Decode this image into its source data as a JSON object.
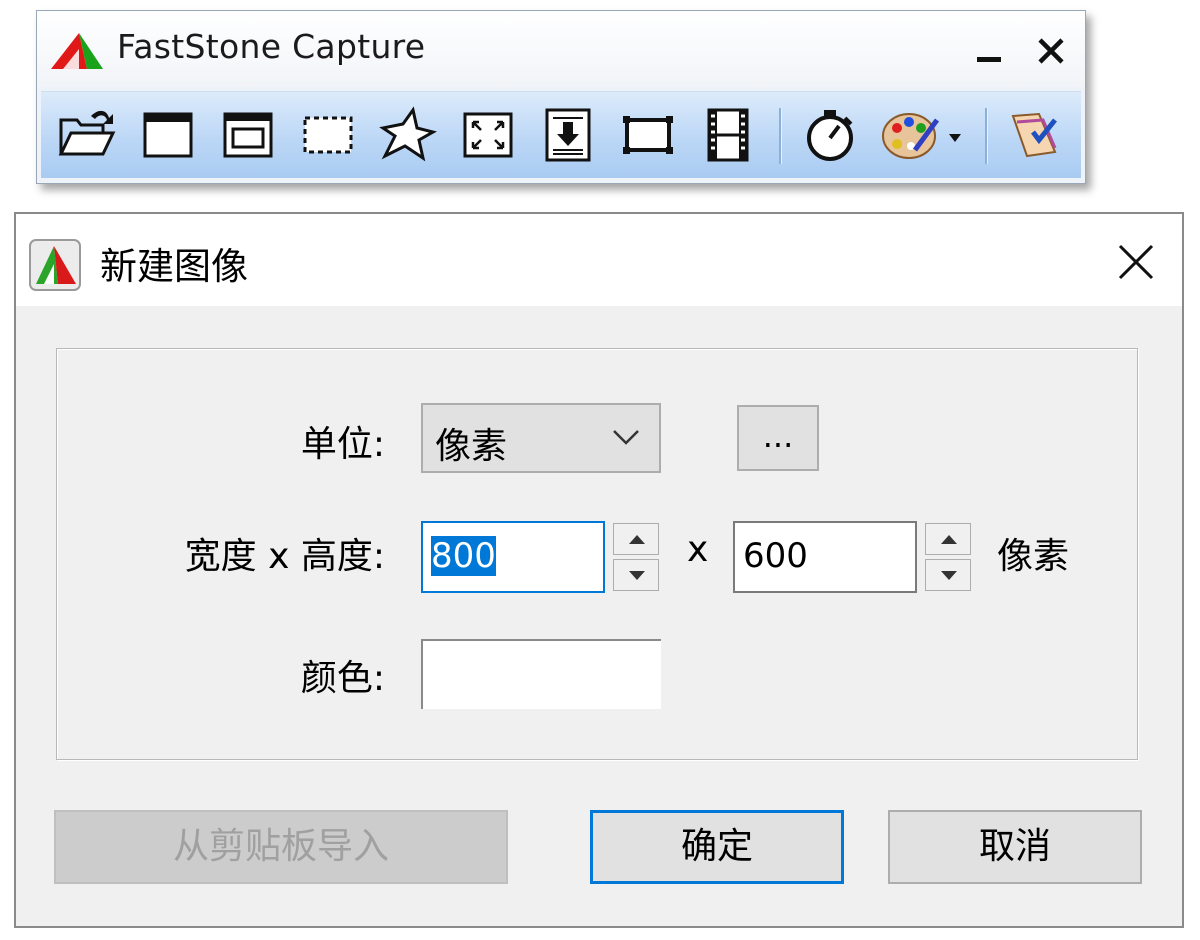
{
  "toolbar_window": {
    "title": "FastStone Capture",
    "buttons": [
      {
        "name": "open-icon"
      },
      {
        "name": "capture-window-icon"
      },
      {
        "name": "capture-object-icon"
      },
      {
        "name": "capture-rectangle-icon"
      },
      {
        "name": "capture-freehand-icon"
      },
      {
        "name": "capture-fullscreen-icon"
      },
      {
        "name": "capture-scrolling-icon"
      },
      {
        "name": "capture-fixed-region-icon"
      },
      {
        "name": "screen-recorder-icon"
      },
      {
        "name": "delay-timer-icon"
      },
      {
        "name": "output-palette-icon"
      },
      {
        "name": "settings-icon"
      }
    ]
  },
  "dialog": {
    "title": "新建图像",
    "unit_label": "单位:",
    "unit_value": "像素",
    "more_button": "...",
    "size_label": "宽度 x 高度:",
    "width_value": "800",
    "x_separator": "x",
    "height_value": "600",
    "size_unit": "像素",
    "color_label": "颜色:",
    "color_value": "#ffffff",
    "import_button": "从剪贴板导入",
    "ok_button": "确定",
    "cancel_button": "取消"
  },
  "colors": {
    "accent": "#0078d7",
    "toolbar_gradient_top": "#dcebfb",
    "toolbar_gradient_bottom": "#a9cbf2"
  }
}
